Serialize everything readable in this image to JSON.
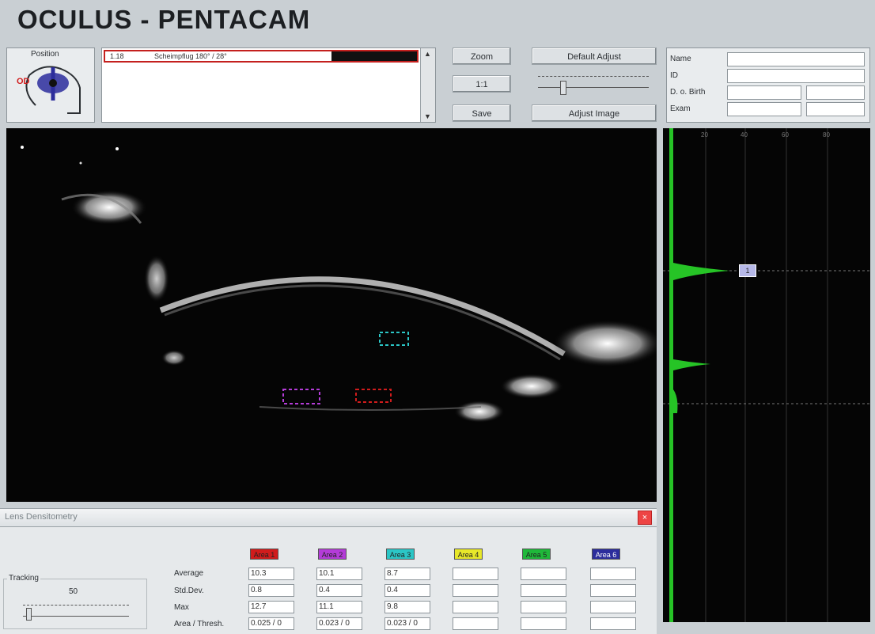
{
  "app": {
    "title": "OCULUS - PENTACAM"
  },
  "position_panel": {
    "label": "Position",
    "eye": "OD"
  },
  "exam_list": {
    "selected_left": "1.18",
    "selected_text": "Scheimpflug 180° / 28°"
  },
  "buttons": {
    "zoom": "Zoom",
    "center": "1:1",
    "save": "Save",
    "default_adjust": "Default Adjust",
    "adjust_image": "Adjust Image"
  },
  "patient": {
    "name_label": "Name",
    "id_label": "ID",
    "dob_label": "D. o. Birth",
    "exam_label": "Exam"
  },
  "graph": {
    "ticks": [
      "20",
      "40",
      "60",
      "80"
    ],
    "marker": "1"
  },
  "lens_panel": {
    "title": "Lens Densitometry",
    "tracking_label": "Tracking",
    "tracking_value": "50",
    "row_labels": [
      "Average",
      "Std.Dev.",
      "Max",
      "Area / Thresh."
    ],
    "areas": [
      {
        "name": "Area 1",
        "color": "#d01c1c",
        "values": [
          "10.3",
          "0.8",
          "12.7",
          "0.025 / 0"
        ]
      },
      {
        "name": "Area 2",
        "color": "#b43cd8",
        "values": [
          "10.1",
          "0.4",
          "11.1",
          "0.023 / 0"
        ]
      },
      {
        "name": "Area 3",
        "color": "#2bc6c6",
        "values": [
          "8.7",
          "0.4",
          "9.8",
          "0.023 / 0"
        ]
      },
      {
        "name": "Area 4",
        "color": "#e8e82a",
        "values": [
          "",
          "",
          "",
          ""
        ]
      },
      {
        "name": "Area 5",
        "color": "#1fb83a",
        "values": [
          "",
          "",
          "",
          ""
        ]
      },
      {
        "name": "Area 6",
        "color": "#2c2d9c",
        "values": [
          "",
          "",
          "",
          ""
        ]
      }
    ]
  }
}
